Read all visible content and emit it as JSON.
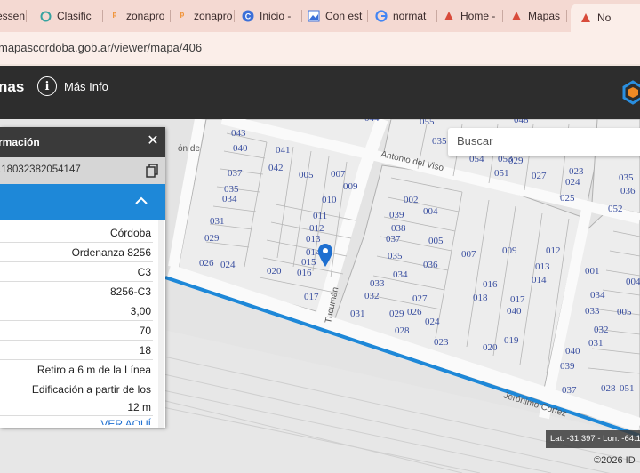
{
  "browser": {
    "tabs": [
      {
        "label": "essen",
        "favicon": "doc-icon"
      },
      {
        "label": "Clasific",
        "favicon": "gear-icon"
      },
      {
        "label": "zonapro",
        "favicon": "key-icon"
      },
      {
        "label": "zonapro",
        "favicon": "key-icon"
      },
      {
        "label": "Inicio -",
        "favicon": "c-icon"
      },
      {
        "label": "Con est",
        "favicon": "image-icon"
      },
      {
        "label": "normat",
        "favicon": "google-icon"
      },
      {
        "label": "Home -",
        "favicon": "map-icon"
      },
      {
        "label": "Mapas",
        "favicon": "map-icon"
      },
      {
        "label": "No",
        "favicon": "map-icon"
      }
    ],
    "url": "mapascordoba.gob.ar/viewer/mapa/406"
  },
  "header": {
    "title": "nas",
    "info_label": "Más Info"
  },
  "search": {
    "placeholder": "Buscar"
  },
  "panel": {
    "title": "rmación",
    "coord": ".18032382054147",
    "rows": [
      "Córdoba",
      "Ordenanza 8256",
      "C3",
      "8256-C3",
      "3,00",
      "70",
      "18"
    ],
    "retiro_line1": "Retiro a 6 m de la Línea",
    "edif_line1": "Edificación a partir de los",
    "edif_line2": "12 m",
    "link": "VER AQUÍ"
  },
  "map": {
    "streets": [
      "Antonio del Viso",
      "Tucumán",
      "Jerónimo Cortez",
      "ón de"
    ],
    "lots": [
      "044",
      "043",
      "040",
      "041",
      "042",
      "037",
      "035",
      "034",
      "031",
      "029",
      "026",
      "024",
      "005",
      "007",
      "009",
      "010",
      "011",
      "012",
      "013",
      "014",
      "015",
      "016",
      "017",
      "020",
      "055",
      "035",
      "048",
      "054",
      "053",
      "051",
      "029",
      "027",
      "023",
      "024",
      "025",
      "002",
      "004",
      "039",
      "038",
      "037",
      "035",
      "034",
      "033",
      "032",
      "031",
      "029",
      "026",
      "027",
      "028",
      "024",
      "023",
      "005",
      "036",
      "007",
      "009",
      "012",
      "013",
      "014",
      "016",
      "017",
      "018",
      "040",
      "019",
      "020",
      "001",
      "034",
      "033",
      "032",
      "031",
      "040",
      "039",
      "037",
      "028",
      "051",
      "005",
      "036",
      "052",
      "035",
      "004"
    ],
    "pin_color": "#1e6fd0",
    "railway_color": "#1e88d8"
  },
  "footer": {
    "coords": "Lat: -31.397 - Lon: -64.181",
    "attribution": "©2026 ID"
  }
}
